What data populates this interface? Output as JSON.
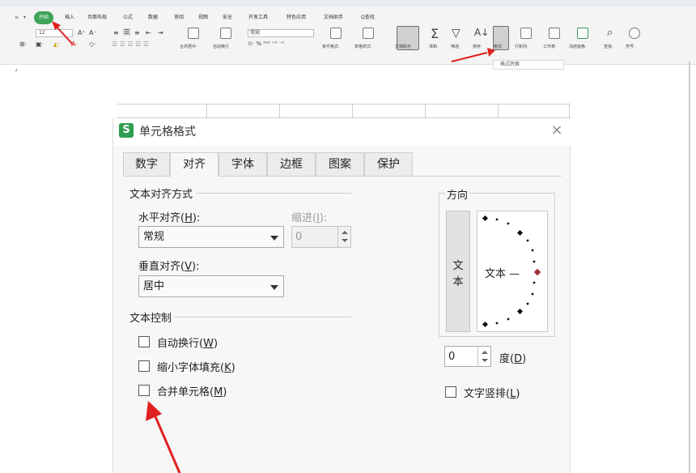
{
  "ribbon": {
    "tabs": [
      {
        "label": "开始",
        "active": true
      },
      {
        "label": "插入"
      },
      {
        "label": "页面布局"
      },
      {
        "label": "公式"
      },
      {
        "label": "数据"
      },
      {
        "label": "审阅"
      },
      {
        "label": "视图"
      },
      {
        "label": "安全"
      },
      {
        "label": "开发工具"
      },
      {
        "label": "特色应用"
      },
      {
        "label": "文档助手"
      },
      {
        "label": "Q查找"
      }
    ],
    "font_size_value": "12",
    "number_format_value": "常规",
    "labels": {
      "merge_center": "合并居中·",
      "auto_wrap": "自动换行",
      "cond_format": "条件格式·",
      "table_style": "表格样式·",
      "doc_helper": "文档助手",
      "sum": "求和·",
      "filter": "筛选·",
      "sort": "排序·",
      "format": "格式·",
      "row_col": "行和列·",
      "worksheet": "工作表·",
      "freeze": "冻结窗格·",
      "find": "查找·",
      "symbol": "符号·"
    },
    "tooltip": "格式转换",
    "colors": {
      "active_tab": "#3fa35a",
      "arrow": "#e02020"
    }
  },
  "dialog": {
    "title": "单元格格式",
    "logo": "S",
    "close": "×",
    "tabs": [
      "数字",
      "对齐",
      "字体",
      "边框",
      "图案",
      "保护"
    ],
    "active_tab": "对齐",
    "text_align_section": "文本对齐方式",
    "horizontal": {
      "label": "水平对齐(",
      "key": "H",
      "suffix": "):",
      "value": "常规"
    },
    "indent": {
      "label": "缩进(",
      "key": "I",
      "suffix": "):",
      "value": "0"
    },
    "vertical": {
      "label": "垂直对齐(",
      "key": "V",
      "suffix": "):",
      "value": "居中"
    },
    "text_control_section": "文本控制",
    "checkboxes": [
      {
        "label": "自动换行(",
        "key": "W",
        "suffix": ")",
        "checked": false
      },
      {
        "label": "缩小字体填充(",
        "key": "K",
        "suffix": ")",
        "checked": false
      },
      {
        "label": "合并单元格(",
        "key": "M",
        "suffix": ")",
        "checked": false
      }
    ],
    "orientation": {
      "section": "方向",
      "vertical_chars": [
        "文",
        "本"
      ],
      "dial_text": "文本 —",
      "degrees_value": "0",
      "degrees_label": "度(",
      "degrees_key": "D",
      "degrees_suffix": ")",
      "vertical_text_label": "文字竖排(",
      "vertical_text_key": "L",
      "vertical_text_suffix": ")",
      "vertical_text_checked": false
    }
  }
}
